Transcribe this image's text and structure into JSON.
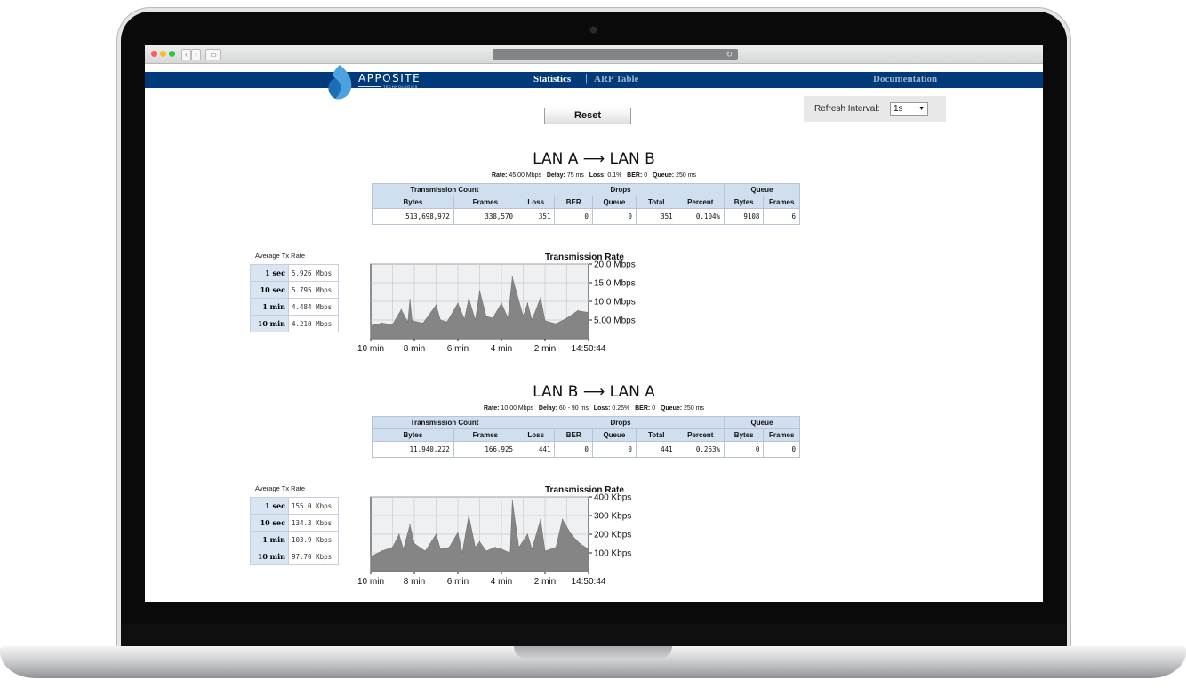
{
  "browser": {
    "back": "‹",
    "forward": "›",
    "sidebar": "▭",
    "reload": "↻"
  },
  "header": {
    "logo_name": "APPOSITE",
    "logo_tagline": "TECHNOLOGIES",
    "nav_statistics": "Statistics",
    "nav_separator": "|",
    "nav_arp": "ARP Table",
    "nav_documentation": "Documentation",
    "brand_color": "#003a78"
  },
  "controls": {
    "reset_label": "Reset",
    "refresh_label": "Refresh Interval:",
    "refresh_value": "1s",
    "refresh_arrow": "▼"
  },
  "table_headers": {
    "transmission_count": "Transmission Count",
    "drops": "Drops",
    "queue": "Queue",
    "cols": [
      "Bytes",
      "Frames",
      "Loss",
      "BER",
      "Queue",
      "Total",
      "Percent",
      "Bytes",
      "Frames"
    ]
  },
  "avg_label": "Average Tx Rate",
  "chart_title": "Transmission Rate",
  "directions": [
    {
      "title": "LAN A ⟶ LAN B",
      "params": [
        {
          "k": "Rate:",
          "v": "45.00 Mbps"
        },
        {
          "k": "Delay:",
          "v": "75 ms"
        },
        {
          "k": "Loss:",
          "v": "0.1%"
        },
        {
          "k": "BER:",
          "v": "0"
        },
        {
          "k": "Queue:",
          "v": "250 ms"
        }
      ],
      "row": [
        "513,698,972",
        "338,570",
        "351",
        "0",
        "0",
        "351",
        "0.104%",
        "9108",
        "6"
      ],
      "avg": [
        {
          "k": "1 sec",
          "v": "5.926 Mbps"
        },
        {
          "k": "10 sec",
          "v": "5.795 Mbps"
        },
        {
          "k": "1 min",
          "v": "4.484 Mbps"
        },
        {
          "k": "10 min",
          "v": "4.210 Mbps"
        }
      ]
    },
    {
      "title": "LAN B ⟶ LAN A",
      "params": [
        {
          "k": "Rate:",
          "v": "10.00 Mbps"
        },
        {
          "k": "Delay:",
          "v": "60 - 90 ms"
        },
        {
          "k": "Loss:",
          "v": "0.25%"
        },
        {
          "k": "BER:",
          "v": "0"
        },
        {
          "k": "Queue:",
          "v": "250 ms"
        }
      ],
      "row": [
        "11,940,222",
        "166,925",
        "441",
        "0",
        "0",
        "441",
        "0.263%",
        "0",
        "0"
      ],
      "avg": [
        {
          "k": "1 sec",
          "v": "155.0 Kbps"
        },
        {
          "k": "10 sec",
          "v": "134.3 Kbps"
        },
        {
          "k": "1 min",
          "v": "103.9 Kbps"
        },
        {
          "k": "10 min",
          "v": "97.70 Kbps"
        }
      ]
    }
  ],
  "chart_data": [
    {
      "type": "area",
      "title": "Transmission Rate",
      "x_ticks": [
        "10 min",
        "8 min",
        "6 min",
        "4 min",
        "2 min",
        "14:50:44"
      ],
      "y_ticks": [
        "20.0 Mbps",
        "15.0 Mbps",
        "10.0 Mbps",
        "5.00 Mbps"
      ],
      "y_tick_values": [
        20,
        15,
        10,
        5
      ],
      "ylim": [
        0,
        20
      ],
      "unit": "Mbps",
      "x_minutes_ago": [
        10,
        9.5,
        9,
        8.6,
        8.3,
        8.2,
        8.1,
        7.6,
        7.0,
        6.8,
        6.5,
        6.0,
        5.7,
        5.5,
        5.2,
        5.0,
        4.7,
        4.4,
        4.0,
        3.7,
        3.5,
        3.0,
        2.8,
        2.6,
        2.2,
        2.0,
        1.5,
        1.0,
        0.5,
        0
      ],
      "values": [
        3.5,
        4.2,
        3.8,
        7.8,
        4.5,
        10.5,
        4.8,
        4.2,
        9.0,
        5.0,
        4.5,
        9.5,
        5.2,
        10.8,
        5.0,
        12.8,
        6.0,
        5.5,
        9.5,
        5.5,
        16.5,
        6.0,
        9.5,
        5.0,
        11.0,
        4.8,
        4.0,
        5.5,
        7.5,
        7.0
      ],
      "grid": true
    },
    {
      "type": "area",
      "title": "Transmission Rate",
      "x_ticks": [
        "10 min",
        "8 min",
        "6 min",
        "4 min",
        "2 min",
        "14:50:44"
      ],
      "y_ticks": [
        "400 Kbps",
        "300 Kbps",
        "200 Kbps",
        "100 Kbps"
      ],
      "y_tick_values": [
        400,
        300,
        200,
        100
      ],
      "ylim": [
        0,
        400
      ],
      "unit": "Kbps",
      "x_minutes_ago": [
        10,
        9.5,
        9,
        8.7,
        8.5,
        8.2,
        8.0,
        7.5,
        7.0,
        6.8,
        6.4,
        6.0,
        5.8,
        5.5,
        5.2,
        5.0,
        4.7,
        4.3,
        4.0,
        3.6,
        3.5,
        3.2,
        2.8,
        2.6,
        2.2,
        2.0,
        1.5,
        1.2,
        0.8,
        0.4,
        0
      ],
      "values": [
        80,
        110,
        130,
        200,
        120,
        250,
        150,
        110,
        200,
        120,
        130,
        210,
        100,
        300,
        130,
        160,
        110,
        130,
        120,
        100,
        380,
        130,
        200,
        120,
        280,
        110,
        130,
        280,
        200,
        150,
        120
      ],
      "grid": true
    }
  ]
}
